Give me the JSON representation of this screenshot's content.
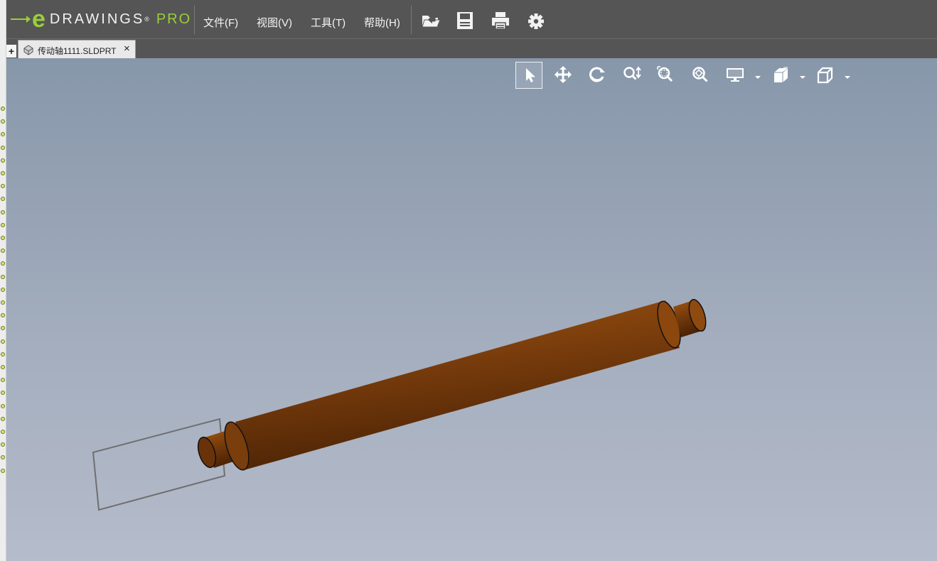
{
  "app": {
    "logo_brand": "DRAWINGS",
    "logo_reg": "®",
    "logo_pro": "PRO"
  },
  "menu": {
    "file": "文件(F)",
    "view": "视图(V)",
    "tools": "工具(T)",
    "help": "帮助(H)"
  },
  "toolbar_icons": [
    "open-folder-icon",
    "save-icon",
    "print-icon",
    "settings-gear-icon"
  ],
  "tab": {
    "add_label": "+",
    "title": "传动轴1111.SLDPRT",
    "close": "×"
  },
  "view_toolbar": {
    "tools": [
      "select-arrow-icon",
      "pan-icon",
      "rotate-icon",
      "zoom-icon",
      "zoom-to-area-icon",
      "zoom-to-fit-icon",
      "display-style-icon",
      "section-view-icon",
      "standard-views-icon"
    ],
    "active": "select-arrow-icon"
  },
  "model": {
    "name": "传动轴",
    "color": "#7a3d0c",
    "highlight_color": "#a3570f"
  },
  "colors": {
    "titlebar": "#555555",
    "accent_green": "#9acd3a",
    "viewport_top": "#8797aa",
    "viewport_bottom": "#b5bccb"
  }
}
